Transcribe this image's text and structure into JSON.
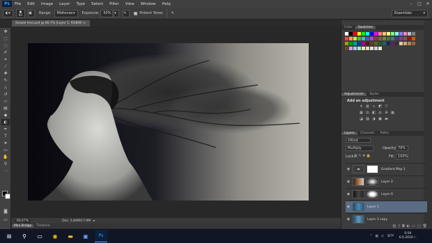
{
  "menubar": {
    "logo": "Ps",
    "items": [
      "File",
      "Edit",
      "Image",
      "Layer",
      "Type",
      "Select",
      "Filter",
      "View",
      "Window",
      "Help"
    ],
    "minimize": "–",
    "maximize": "□",
    "close": "✕"
  },
  "options": {
    "brush_size": "65",
    "range_label": "Range:",
    "range_value": "Midtones",
    "exposure_label": "Exposure:",
    "exposure_value": "50%",
    "protect_tones": "Protect Tones",
    "workspace": "Essentials"
  },
  "document": {
    "tab_title": "Simple tree.psd @ 66,7% (Layer 1, RGB/8)",
    "zoom": "66,67%",
    "doc_info": "Doc: 2,84M/17,9M"
  },
  "bottom_tabs": {
    "mini_bridge": "Mini Bridge",
    "timeline": "Timeline"
  },
  "panels": {
    "color_tab": "Color",
    "swatches_tab": "Swatches",
    "adjustments_tab": "Adjustments",
    "styles_tab": "Styles",
    "add_adjustment": "Add an adjustment",
    "layers_tab": "Layers",
    "channels_tab": "Channels",
    "paths_tab": "Paths",
    "kind": "Kind",
    "blend_mode": "Multiply",
    "opacity_label": "Opacity:",
    "opacity_value": "79%",
    "lock_label": "Lock:",
    "fill_label": "Fill:",
    "fill_value": "100%",
    "layers": [
      "Gradient Map 1",
      "Layer 2",
      "Layer 0",
      "Layer 1",
      "Layer 1 copy"
    ],
    "swatch_colors": [
      "#ffffff",
      "#000000",
      "#ff0000",
      "#ffff00",
      "#00ff00",
      "#00ffff",
      "#0000ff",
      "#ff00ff",
      "#ff8080",
      "#ffc080",
      "#ffff80",
      "#80ff80",
      "#80ffff",
      "#8080ff",
      "#ff80c0",
      "#c0c0c0",
      "#808080",
      "#ff4040",
      "#ffa040",
      "#e0e040",
      "#40c040",
      "#40c0c0",
      "#4060c0",
      "#c040c0",
      "#804040",
      "#806040",
      "#808040",
      "#408040",
      "#408080",
      "#404080",
      "#804080",
      "#606060",
      "#c00000",
      "#c06000",
      "#a0a000",
      "#00a000",
      "#00a0a0",
      "#0040a0",
      "#a000a0",
      "#402020",
      "#604020",
      "#606020",
      "#206020",
      "#206060",
      "#202060",
      "#602060",
      "#303030",
      "#e8c8a8",
      "#d0a878",
      "#b08858",
      "#906838",
      "#704818",
      "#c8a8e8",
      "#a8c8e8",
      "#a8e8c8",
      "#e8e8a8",
      "#f0d0d0",
      "#d0f0d0",
      "#d0d0f0",
      "#f0f0d0"
    ]
  },
  "taskbar": {
    "lang": "БГР",
    "time": "0:04",
    "date": "6.6.2016 г."
  }
}
